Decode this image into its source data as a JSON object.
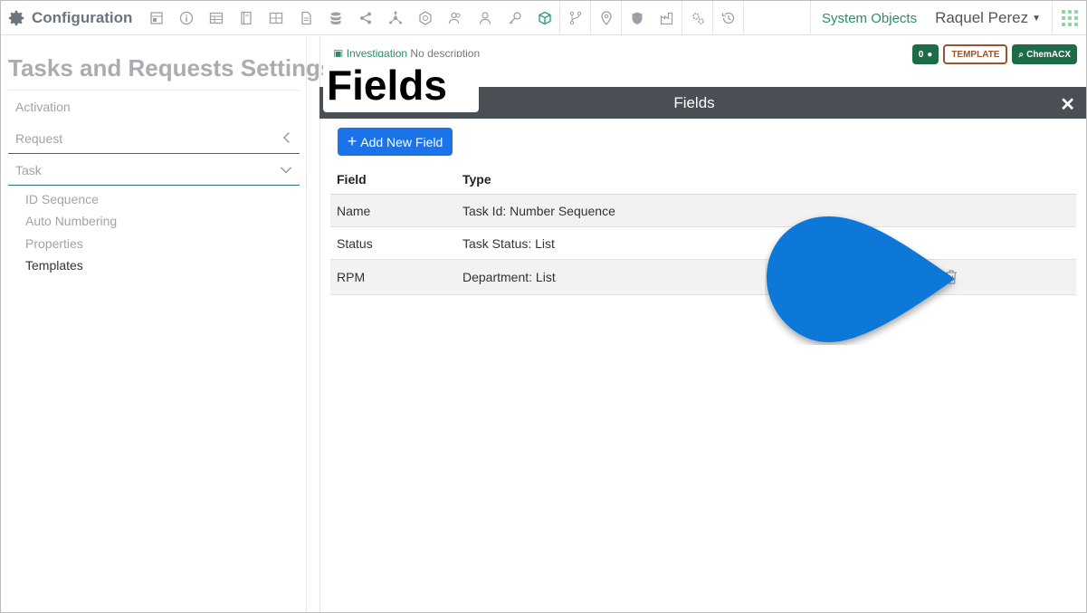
{
  "app": {
    "title": "Configuration"
  },
  "nav": {
    "icons": [
      "layout-icon",
      "info-icon",
      "table-icon",
      "notebook-icon",
      "grid-icon",
      "document-icon",
      "database-icon",
      "share-icon",
      "network-icon",
      "badge-icon",
      "users-icon",
      "user-icon",
      "key-icon",
      "cube-icon",
      "branch-icon",
      "location-icon",
      "shield-icon",
      "factory-icon",
      "cogs-icon",
      "history-icon"
    ],
    "system_objects": "System Objects",
    "user_name": "Raquel Perez"
  },
  "sidebar": {
    "title": "Tasks and Requests Settings",
    "items": [
      {
        "label": "Activation"
      },
      {
        "label": "Request"
      },
      {
        "label": "Task"
      }
    ],
    "sub_items": [
      {
        "label": "ID Sequence"
      },
      {
        "label": "Auto Numbering"
      },
      {
        "label": "Properties"
      },
      {
        "label": "Templates"
      }
    ]
  },
  "record": {
    "name": "Investigation",
    "description": "No description"
  },
  "badges": {
    "count": "0",
    "template": "TEMPLATE",
    "chem": "ChemACX"
  },
  "overlay": {
    "label": "Fields"
  },
  "panel": {
    "title": "Fields",
    "close": "✕",
    "add_button": "Add New Field",
    "columns": {
      "field": "Field",
      "type": "Type"
    },
    "rows": [
      {
        "field": "Name",
        "type": "Task Id: Number Sequence"
      },
      {
        "field": "Status",
        "type": "Task Status: List"
      },
      {
        "field": "RPM",
        "type": "Department: List"
      }
    ]
  },
  "colors": {
    "accent_green": "#1e6b48",
    "primary_blue": "#1a73e8",
    "pointer_blue": "#0b78d8",
    "panel_header": "#4a4f55"
  }
}
